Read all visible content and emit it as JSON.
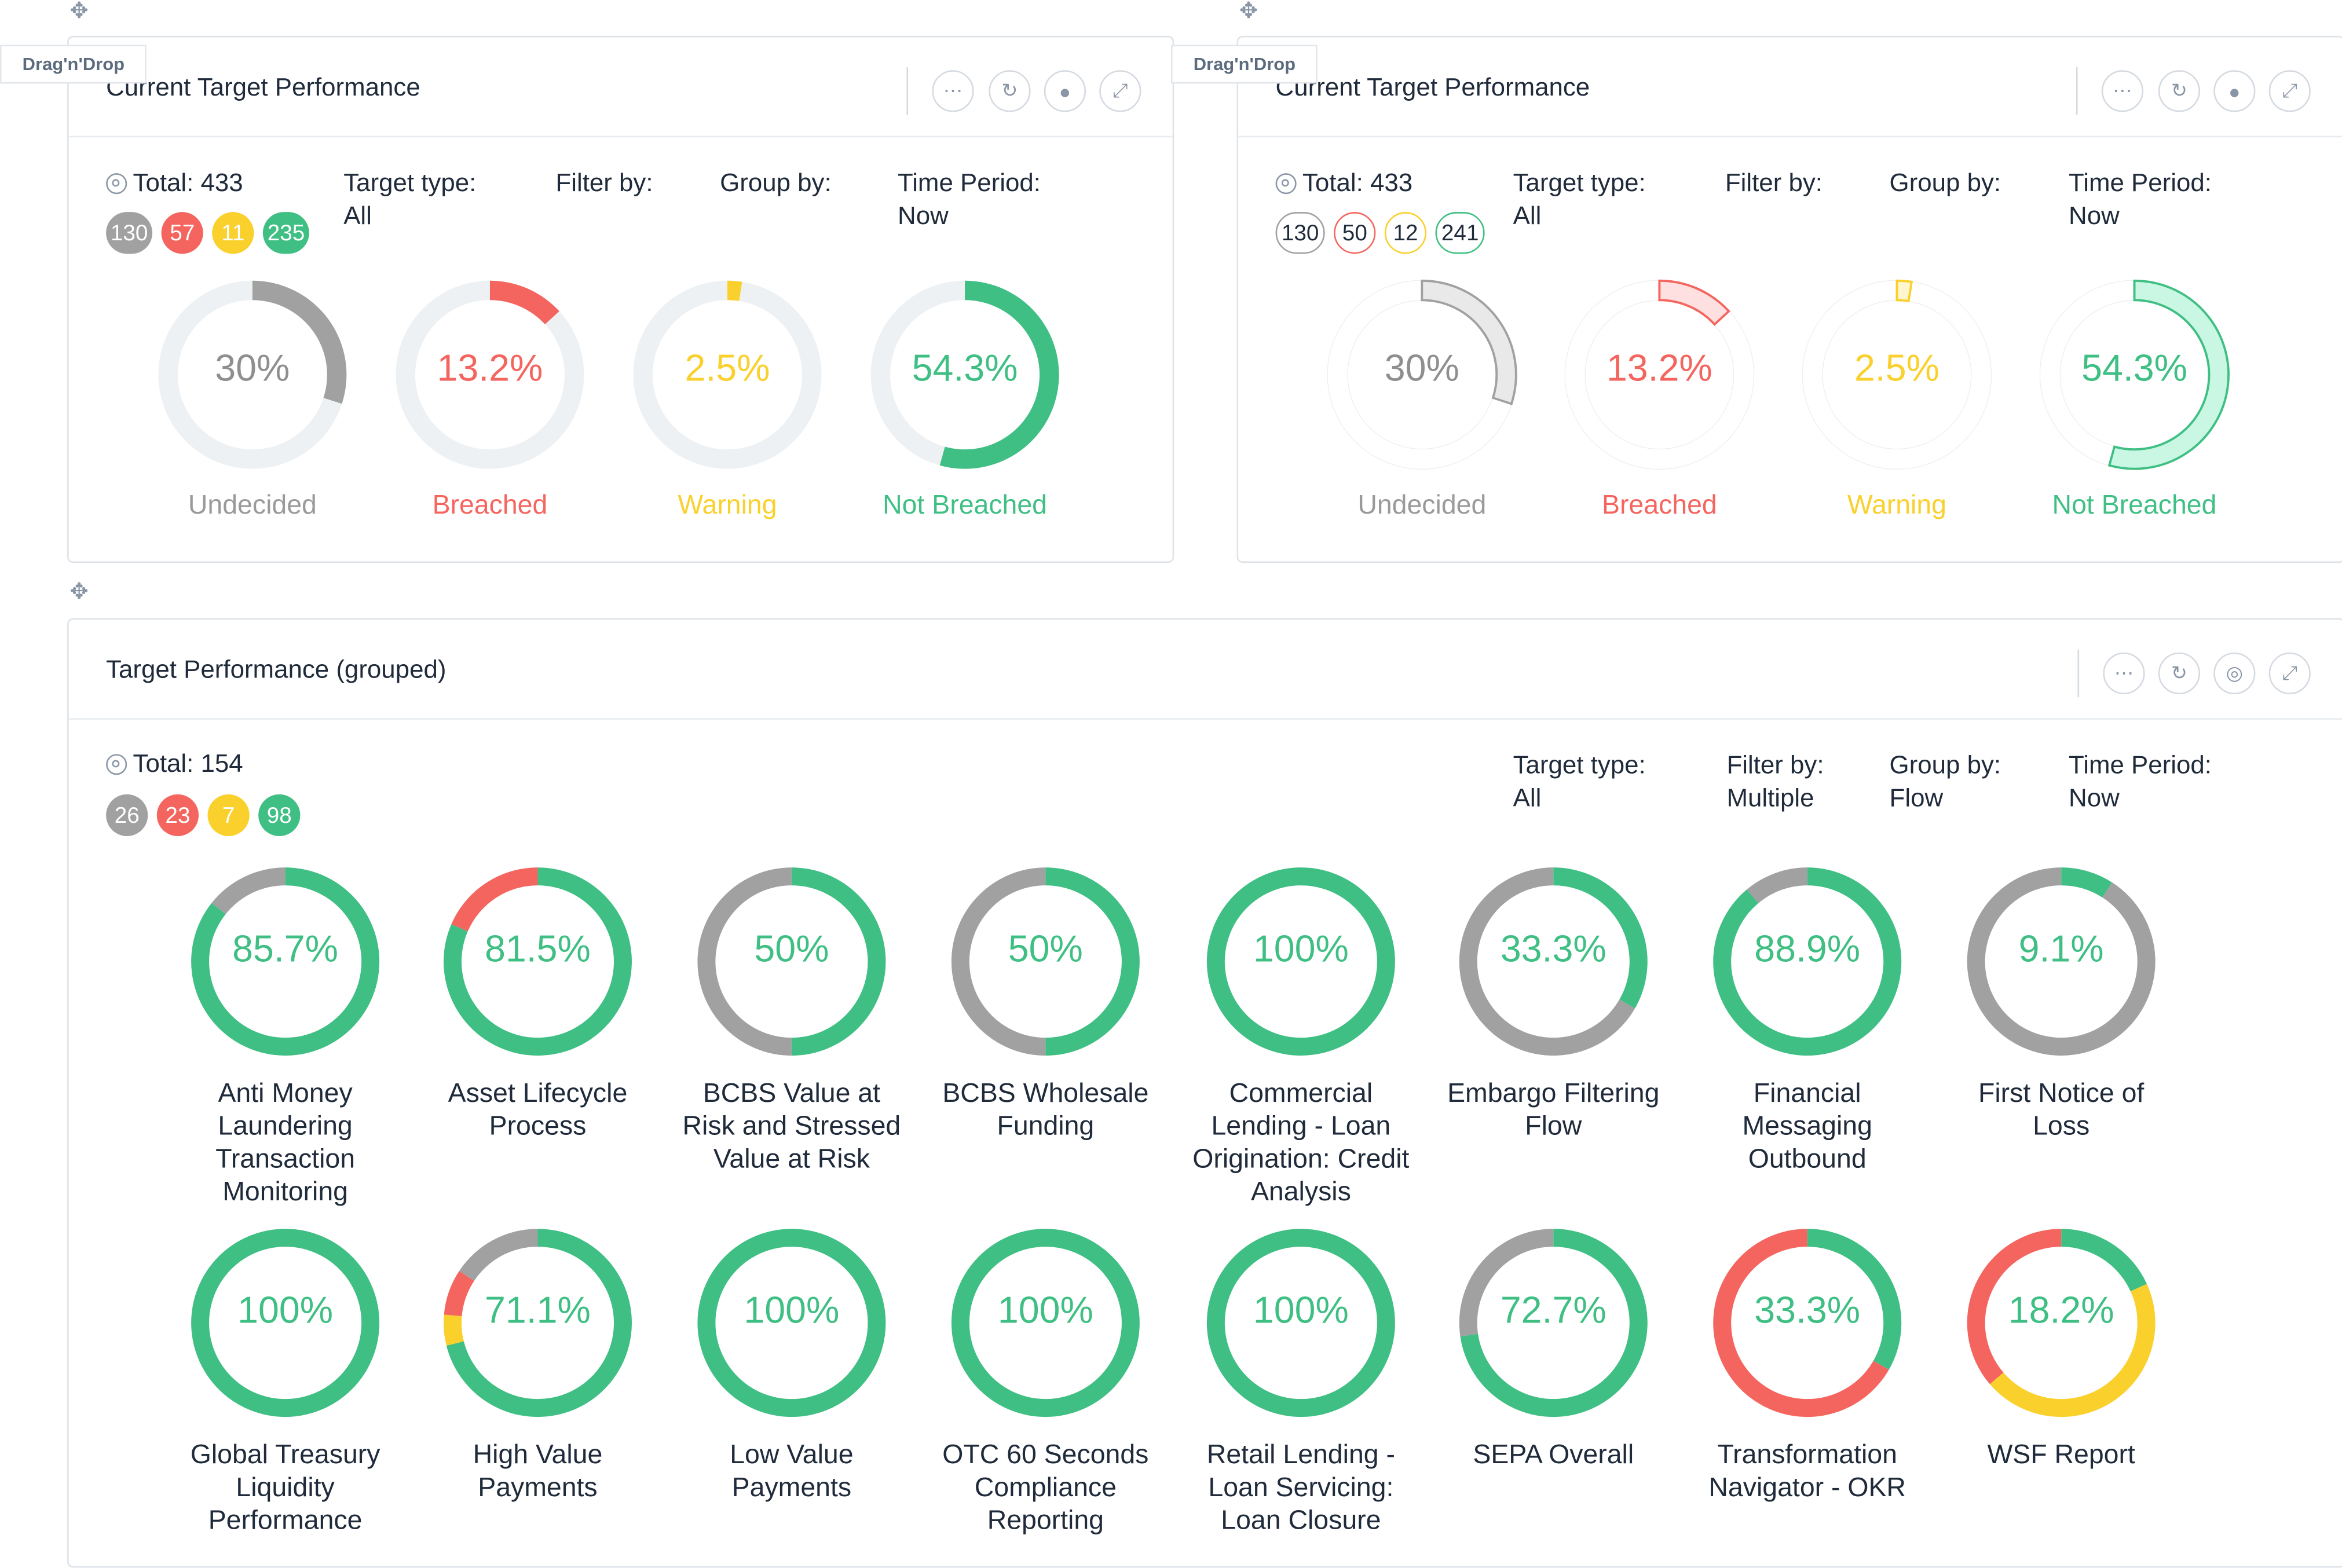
{
  "colors": {
    "gray": "#a1a1a1",
    "red": "#f5655f",
    "yellow": "#fad02c",
    "green": "#3fbf83",
    "track": "#eef1f3"
  },
  "icons": {
    "move": "move-icon",
    "more": "more-icon",
    "refresh": "refresh-icon",
    "user": "user-icon",
    "globe": "globe-icon",
    "expand": "expand-icon",
    "target": "target-icon"
  },
  "dnd_label": "Drag'n'Drop",
  "panel_left": {
    "title": "Current Target Performance",
    "total": "Total: 433",
    "badges": [
      "130",
      "57",
      "11",
      "235"
    ],
    "target_type": {
      "label": "Target type:",
      "value": "All"
    },
    "filter_by": {
      "label": "Filter by:",
      "value": ""
    },
    "group_by": {
      "label": "Group by:",
      "value": ""
    },
    "time_period": {
      "label": "Time Period:",
      "value": "Now"
    },
    "gauges": [
      {
        "pct": "30%",
        "label": "Undecided",
        "value": 30,
        "color": "gray"
      },
      {
        "pct": "13.2%",
        "label": "Breached",
        "value": 13.2,
        "color": "red"
      },
      {
        "pct": "2.5%",
        "label": "Warning",
        "value": 2.5,
        "color": "yellow"
      },
      {
        "pct": "54.3%",
        "label": "Not Breached",
        "value": 54.3,
        "color": "green"
      }
    ]
  },
  "panel_right": {
    "title": "Current Target Performance",
    "total": "Total: 433",
    "badges": [
      "130",
      "50",
      "12",
      "241"
    ],
    "target_type": {
      "label": "Target type:",
      "value": "All"
    },
    "filter_by": {
      "label": "Filter by:",
      "value": ""
    },
    "group_by": {
      "label": "Group by:",
      "value": ""
    },
    "time_period": {
      "label": "Time Period:",
      "value": "Now"
    },
    "gauges": [
      {
        "pct": "30%",
        "label": "Undecided",
        "value": 30,
        "color": "gray"
      },
      {
        "pct": "13.2%",
        "label": "Breached",
        "value": 13.2,
        "color": "red"
      },
      {
        "pct": "2.5%",
        "label": "Warning",
        "value": 2.5,
        "color": "yellow"
      },
      {
        "pct": "54.3%",
        "label": "Not Breached",
        "value": 54.3,
        "color": "green"
      }
    ]
  },
  "panel_grouped": {
    "title": "Target Performance (grouped)",
    "total": "Total: 154",
    "badges": [
      "26",
      "23",
      "7",
      "98"
    ],
    "target_type": {
      "label": "Target type:",
      "value": "All"
    },
    "filter_by": {
      "label": "Filter by:",
      "value": "Multiple"
    },
    "group_by": {
      "label": "Group by:",
      "value": "Flow"
    },
    "time_period": {
      "label": "Time Period:",
      "value": "Now"
    },
    "flows": [
      {
        "pct": "85.7%",
        "label": "Anti Money Laundering Transaction Monitoring",
        "segments": [
          {
            "color": "green",
            "share": 85.7
          },
          {
            "color": "gray",
            "share": 14.3
          }
        ]
      },
      {
        "pct": "81.5%",
        "label": "Asset Lifecycle Process",
        "segments": [
          {
            "color": "green",
            "share": 81.5
          },
          {
            "color": "red",
            "share": 18.5
          }
        ]
      },
      {
        "pct": "50%",
        "label": "BCBS Value at Risk and Stressed Value at Risk",
        "segments": [
          {
            "color": "green",
            "share": 50
          },
          {
            "color": "gray",
            "share": 50
          }
        ]
      },
      {
        "pct": "50%",
        "label": "BCBS Wholesale Funding",
        "segments": [
          {
            "color": "green",
            "share": 50
          },
          {
            "color": "gray",
            "share": 50
          }
        ]
      },
      {
        "pct": "100%",
        "label": "Commercial Lending - Loan Origination: Credit Analysis",
        "segments": [
          {
            "color": "green",
            "share": 100
          }
        ]
      },
      {
        "pct": "33.3%",
        "label": "Embargo Filtering Flow",
        "segments": [
          {
            "color": "green",
            "share": 33.3
          },
          {
            "color": "gray",
            "share": 66.7
          }
        ]
      },
      {
        "pct": "88.9%",
        "label": "Financial Messaging Outbound",
        "segments": [
          {
            "color": "green",
            "share": 88.9
          },
          {
            "color": "gray",
            "share": 11.1
          }
        ]
      },
      {
        "pct": "9.1%",
        "label": "First Notice of Loss",
        "segments": [
          {
            "color": "green",
            "share": 9.1
          },
          {
            "color": "gray",
            "share": 90.9
          }
        ]
      },
      {
        "pct": "100%",
        "label": "Global Treasury Liquidity Performance",
        "segments": [
          {
            "color": "green",
            "share": 100
          }
        ]
      },
      {
        "pct": "71.1%",
        "label": "High Value Payments",
        "segments": [
          {
            "color": "green",
            "share": 71.1
          },
          {
            "color": "yellow",
            "share": 5.3
          },
          {
            "color": "red",
            "share": 7.9
          },
          {
            "color": "gray",
            "share": 15.7
          }
        ]
      },
      {
        "pct": "100%",
        "label": "Low Value Payments",
        "segments": [
          {
            "color": "green",
            "share": 100
          }
        ]
      },
      {
        "pct": "100%",
        "label": "OTC 60 Seconds Compliance Reporting",
        "segments": [
          {
            "color": "green",
            "share": 100
          }
        ]
      },
      {
        "pct": "100%",
        "label": "Retail Lending - Loan Servicing: Loan Closure",
        "segments": [
          {
            "color": "green",
            "share": 100
          }
        ]
      },
      {
        "pct": "72.7%",
        "label": "SEPA Overall",
        "segments": [
          {
            "color": "green",
            "share": 72.7
          },
          {
            "color": "gray",
            "share": 27.3
          }
        ]
      },
      {
        "pct": "33.3%",
        "label": "Transformation Navigator - OKR",
        "segments": [
          {
            "color": "green",
            "share": 33.3
          },
          {
            "color": "red",
            "share": 66.7
          }
        ]
      },
      {
        "pct": "18.2%",
        "label": "WSF Report",
        "segments": [
          {
            "color": "green",
            "share": 18.2
          },
          {
            "color": "yellow",
            "share": 45.5
          },
          {
            "color": "red",
            "share": 36.3
          }
        ]
      }
    ]
  }
}
